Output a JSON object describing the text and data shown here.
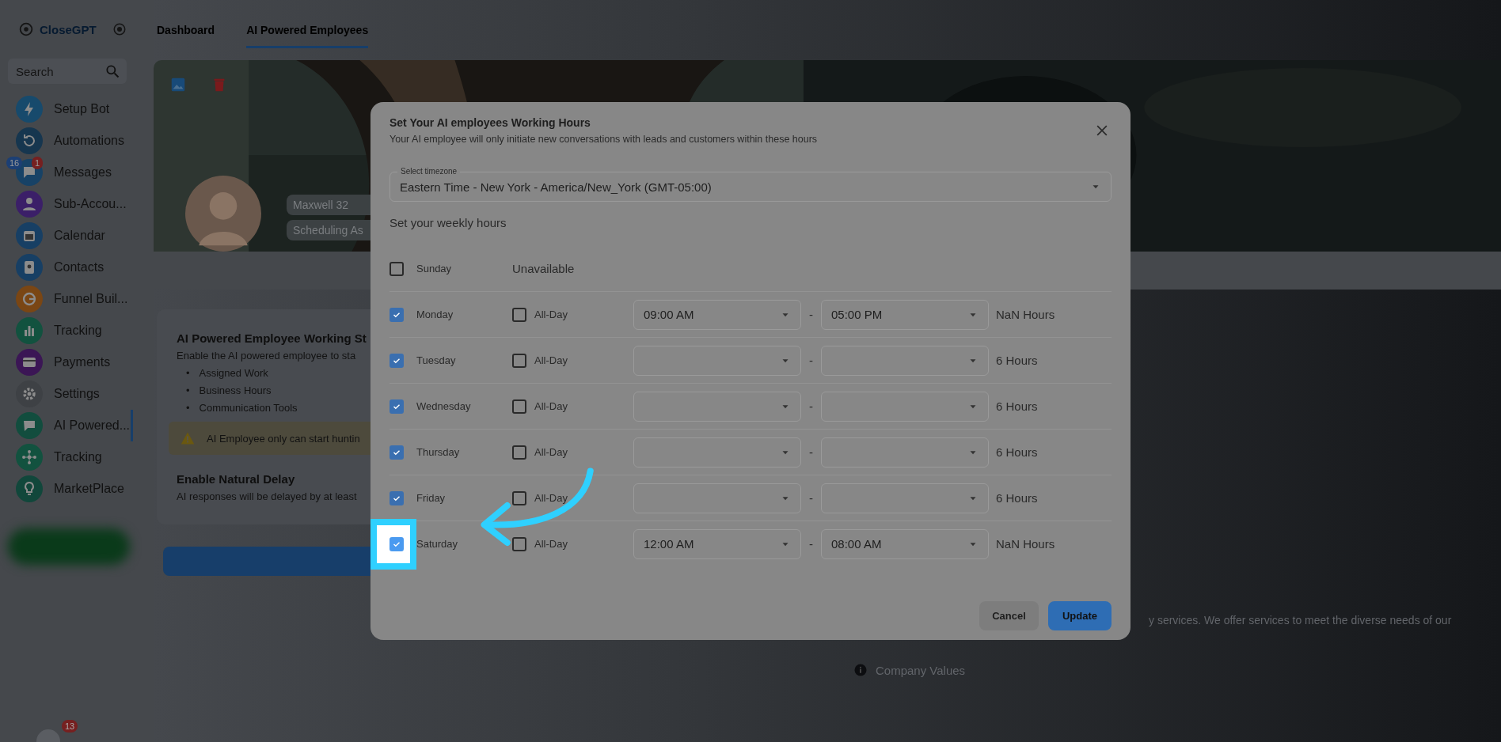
{
  "app": {
    "logo": "CloseGPT"
  },
  "top_nav": [
    {
      "label": "Dashboard",
      "selected": false
    },
    {
      "label": "AI Powered Employees",
      "selected": true
    }
  ],
  "sidebar": {
    "search": {
      "placeholder": "Search"
    },
    "items": [
      {
        "label": "Setup Bot",
        "color": "#174a6c",
        "selected": false
      },
      {
        "label": "Automations",
        "color": "#16364f",
        "selected": false
      },
      {
        "label": "Messages",
        "color": "#174266",
        "selected": false,
        "badges": [
          {
            "text": "16",
            "color": "#1c3f74"
          },
          {
            "text": "1",
            "color": "#762020"
          }
        ]
      },
      {
        "label": "Sub-Accou...",
        "color": "#3b1f68",
        "selected": false
      },
      {
        "label": "Calendar",
        "color": "#173f64",
        "selected": false
      },
      {
        "label": "Contacts",
        "color": "#173f64",
        "selected": false
      },
      {
        "label": "Funnel Buil...",
        "color": "#7a4614",
        "selected": false
      },
      {
        "label": "Tracking",
        "color": "#12523f",
        "selected": false
      },
      {
        "label": "Payments",
        "color": "#3b1655",
        "selected": false
      },
      {
        "label": "Settings",
        "color": "#3e4145",
        "selected": false
      },
      {
        "label": "AI Powered...",
        "color": "#124d3e",
        "selected": true
      },
      {
        "label": "Tracking",
        "color": "#12523f",
        "selected": false
      },
      {
        "label": "MarketPlace",
        "color": "#11473b",
        "selected": false
      }
    ],
    "bottom_badge": "13"
  },
  "employee": {
    "name_tag": "Maxwell 32",
    "role_tag": "Scheduling As"
  },
  "status_card": {
    "title": "AI Powered Employee Working St",
    "text": "Enable the AI powered employee to sta",
    "bullet": "•",
    "list": [
      "Assigned Work",
      "Business Hours",
      "Communication Tools"
    ],
    "warning": "AI Employee only can start huntin",
    "delay_title": "Enable Natural Delay",
    "delay_text": "AI responses will be delayed by at least"
  },
  "about": {
    "text": "y services. We offer services to meet the diverse needs of our",
    "values_heading": "Company Values"
  },
  "dialog": {
    "title": "Set Your AI employees Working Hours",
    "subtitle": "Your AI employee will only initiate new conversations with leads and customers within these hours",
    "timezone": {
      "label": "Select timezone",
      "value": "Eastern Time - New York - America/New_York (GMT-05:00)"
    },
    "section": "Set your weekly hours",
    "days": [
      {
        "label": "Sunday",
        "checked": false,
        "highlighted": false,
        "unavailable": "Unavailable"
      },
      {
        "label": "Monday",
        "checked": true,
        "highlighted": false,
        "all_day": {
          "label": "All-Day",
          "checked": false
        },
        "start": "09:00 AM",
        "separator": "-",
        "end": "05:00 PM",
        "hours": "NaN Hours"
      },
      {
        "label": "Tuesday",
        "checked": true,
        "highlighted": false,
        "all_day": {
          "label": "All-Day",
          "checked": false
        },
        "separator": "-",
        "hours": "6 Hours"
      },
      {
        "label": "Wednesday",
        "checked": true,
        "highlighted": false,
        "all_day": {
          "label": "All-Day",
          "checked": false
        },
        "separator": "-",
        "hours": "6 Hours"
      },
      {
        "label": "Thursday",
        "checked": true,
        "highlighted": false,
        "all_day": {
          "label": "All-Day",
          "checked": false
        },
        "separator": "-",
        "hours": "6 Hours"
      },
      {
        "label": "Friday",
        "checked": true,
        "highlighted": false,
        "all_day": {
          "label": "All-Day",
          "checked": false
        },
        "separator": "-",
        "hours": "6 Hours"
      },
      {
        "label": "Saturday",
        "checked": true,
        "highlighted": true,
        "all_day": {
          "label": "All-Day",
          "checked": false
        },
        "start": "12:00 AM",
        "separator": "-",
        "end": "08:00 AM",
        "hours": "NaN Hours"
      }
    ],
    "buttons": [
      {
        "label": "Cancel",
        "kind": "secondary"
      },
      {
        "label": "Update",
        "kind": "primary"
      }
    ]
  }
}
